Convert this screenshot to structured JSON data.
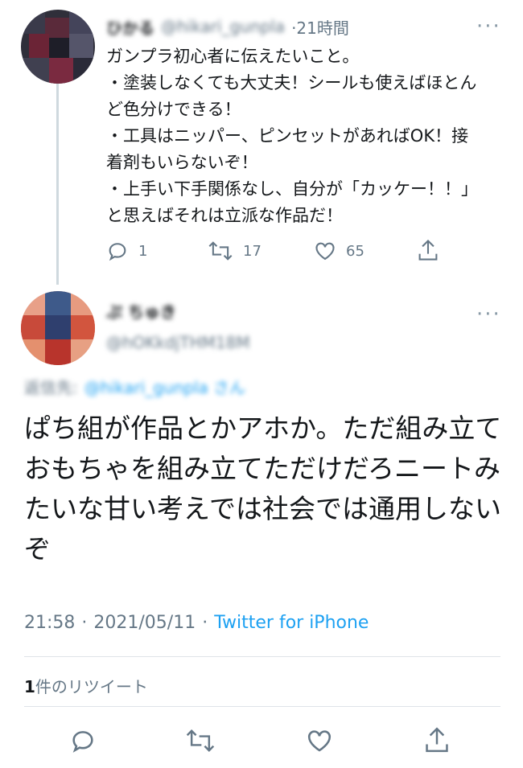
{
  "tweet1": {
    "display_name": "ひかる",
    "handle": "@hikari_gunpla",
    "time": "21時間",
    "text": "ガンプラ初心者に伝えたいこと。\n・塗装しなくても大丈夫！シールも使えばほとんど色分けできる！\n・工具はニッパー、ピンセットがあればOK！接着剤もいらないぞ！\n・上手い下手関係なし、自分が「カッケー！！」と思えばそれは立派な作品だ！",
    "replies": "1",
    "retweets": "17",
    "likes": "65"
  },
  "tweet2": {
    "display_name": "ぷ ちゅき",
    "handle": "@hOKkdjTHM18M",
    "reply_to_label": "返信先:",
    "reply_to_handle": "@hikari_gunpla さん",
    "text": "ぱち組が作品とかアホか。ただ組み立ておもちゃを組み立てただけだろニートみたいな甘い考えでは社会では通用しないぞ",
    "time": "21:58",
    "date": "2021/05/11",
    "source": "Twitter for iPhone",
    "retweet_count": "1",
    "retweet_label": "件のリツイート"
  },
  "icons": {
    "more": "more-dots-icon",
    "reply": "reply-icon",
    "retweet": "retweet-icon",
    "like": "heart-icon",
    "share": "share-icon"
  },
  "colors": {
    "link": "#1da1f2",
    "secondary": "#657786",
    "text": "#14171a",
    "thread_line": "#cfd9de"
  }
}
